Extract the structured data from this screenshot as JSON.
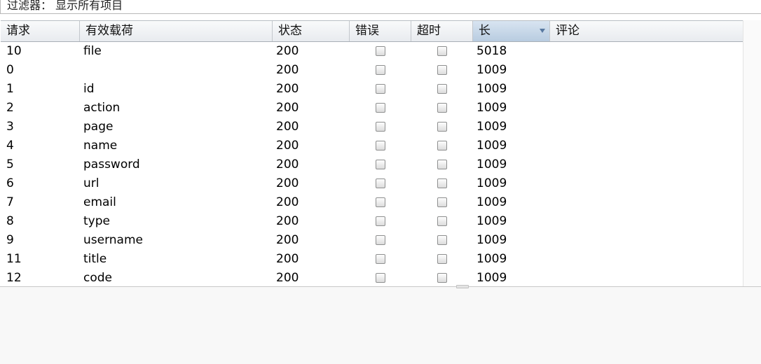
{
  "filter": {
    "label": "过滤器： 显示所有项目"
  },
  "columns": [
    "请求",
    "有效载荷",
    "状态",
    "错误",
    "超时",
    "长",
    "评论"
  ],
  "rows": [
    {
      "request": "10",
      "payload": "file",
      "status": "200",
      "error": false,
      "timeout": false,
      "length": "5018",
      "comment": ""
    },
    {
      "request": "0",
      "payload": "",
      "status": "200",
      "error": false,
      "timeout": false,
      "length": "1009",
      "comment": ""
    },
    {
      "request": "1",
      "payload": "id",
      "status": "200",
      "error": false,
      "timeout": false,
      "length": "1009",
      "comment": ""
    },
    {
      "request": "2",
      "payload": "action",
      "status": "200",
      "error": false,
      "timeout": false,
      "length": "1009",
      "comment": ""
    },
    {
      "request": "3",
      "payload": "page",
      "status": "200",
      "error": false,
      "timeout": false,
      "length": "1009",
      "comment": ""
    },
    {
      "request": "4",
      "payload": "name",
      "status": "200",
      "error": false,
      "timeout": false,
      "length": "1009",
      "comment": ""
    },
    {
      "request": "5",
      "payload": "password",
      "status": "200",
      "error": false,
      "timeout": false,
      "length": "1009",
      "comment": ""
    },
    {
      "request": "6",
      "payload": "url",
      "status": "200",
      "error": false,
      "timeout": false,
      "length": "1009",
      "comment": ""
    },
    {
      "request": "7",
      "payload": "email",
      "status": "200",
      "error": false,
      "timeout": false,
      "length": "1009",
      "comment": ""
    },
    {
      "request": "8",
      "payload": "type",
      "status": "200",
      "error": false,
      "timeout": false,
      "length": "1009",
      "comment": ""
    },
    {
      "request": "9",
      "payload": "username",
      "status": "200",
      "error": false,
      "timeout": false,
      "length": "1009",
      "comment": ""
    },
    {
      "request": "11",
      "payload": "title",
      "status": "200",
      "error": false,
      "timeout": false,
      "length": "1009",
      "comment": ""
    },
    {
      "request": "12",
      "payload": "code",
      "status": "200",
      "error": false,
      "timeout": false,
      "length": "1009",
      "comment": ""
    }
  ],
  "sort": {
    "column": "长",
    "direction": "descending"
  }
}
